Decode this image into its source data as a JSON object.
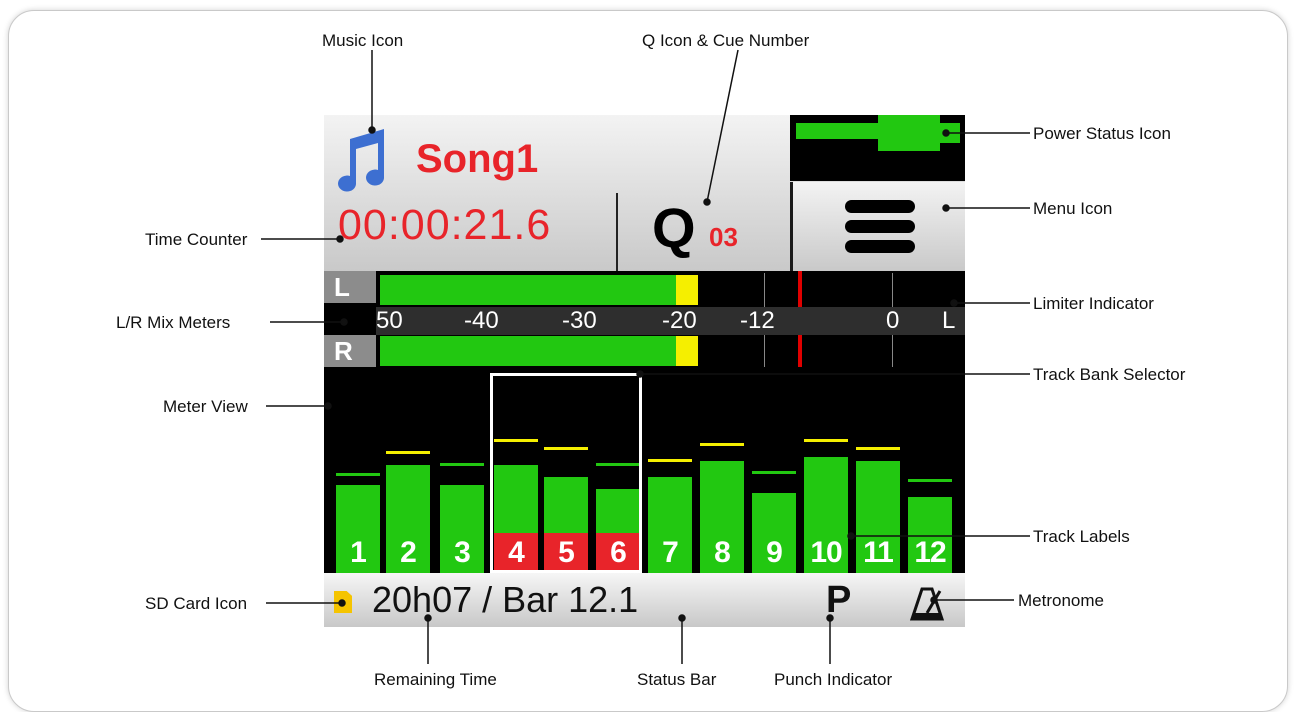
{
  "song": {
    "name": "Song1",
    "time_counter": "00:00:21.6",
    "cue_icon": "Q",
    "cue_number": "03"
  },
  "mix_meters": {
    "channels": [
      "L",
      "R"
    ],
    "scale": [
      "50",
      "-40",
      "-30",
      "-20",
      "-12",
      "0",
      "L"
    ],
    "left_level_fraction": 0.56,
    "right_level_fraction": 0.56
  },
  "tracks": {
    "labels": [
      "1",
      "2",
      "3",
      "4",
      "5",
      "6",
      "7",
      "8",
      "9",
      "10",
      "11",
      "12"
    ],
    "armed_label_color": "#e8242a",
    "normal_label_color": "#22c811"
  },
  "status": {
    "remaining": "20h07 / Bar 12.1",
    "punch": "P"
  },
  "icons": {
    "music": "music-note-icon",
    "power": "battery-power-icon",
    "menu": "hamburger-menu-icon",
    "sd": "sd-card-icon",
    "metronome": "metronome-icon"
  },
  "callouts": {
    "music_icon": "Music Icon",
    "q_icon": "Q Icon & Cue Number",
    "power_status": "Power Status Icon",
    "time_counter": "Time Counter",
    "menu_icon": "Menu Icon",
    "limiter": "Limiter Indicator",
    "mix_meters": "L/R Mix Meters",
    "track_bank": "Track Bank Selector",
    "meter_view": "Meter View",
    "track_labels": "Track Labels",
    "sd_card": "SD Card Icon",
    "metronome": "Metronome",
    "remaining_time": "Remaining Time",
    "status_bar": "Status Bar",
    "punch_indicator": "Punch Indicator"
  }
}
